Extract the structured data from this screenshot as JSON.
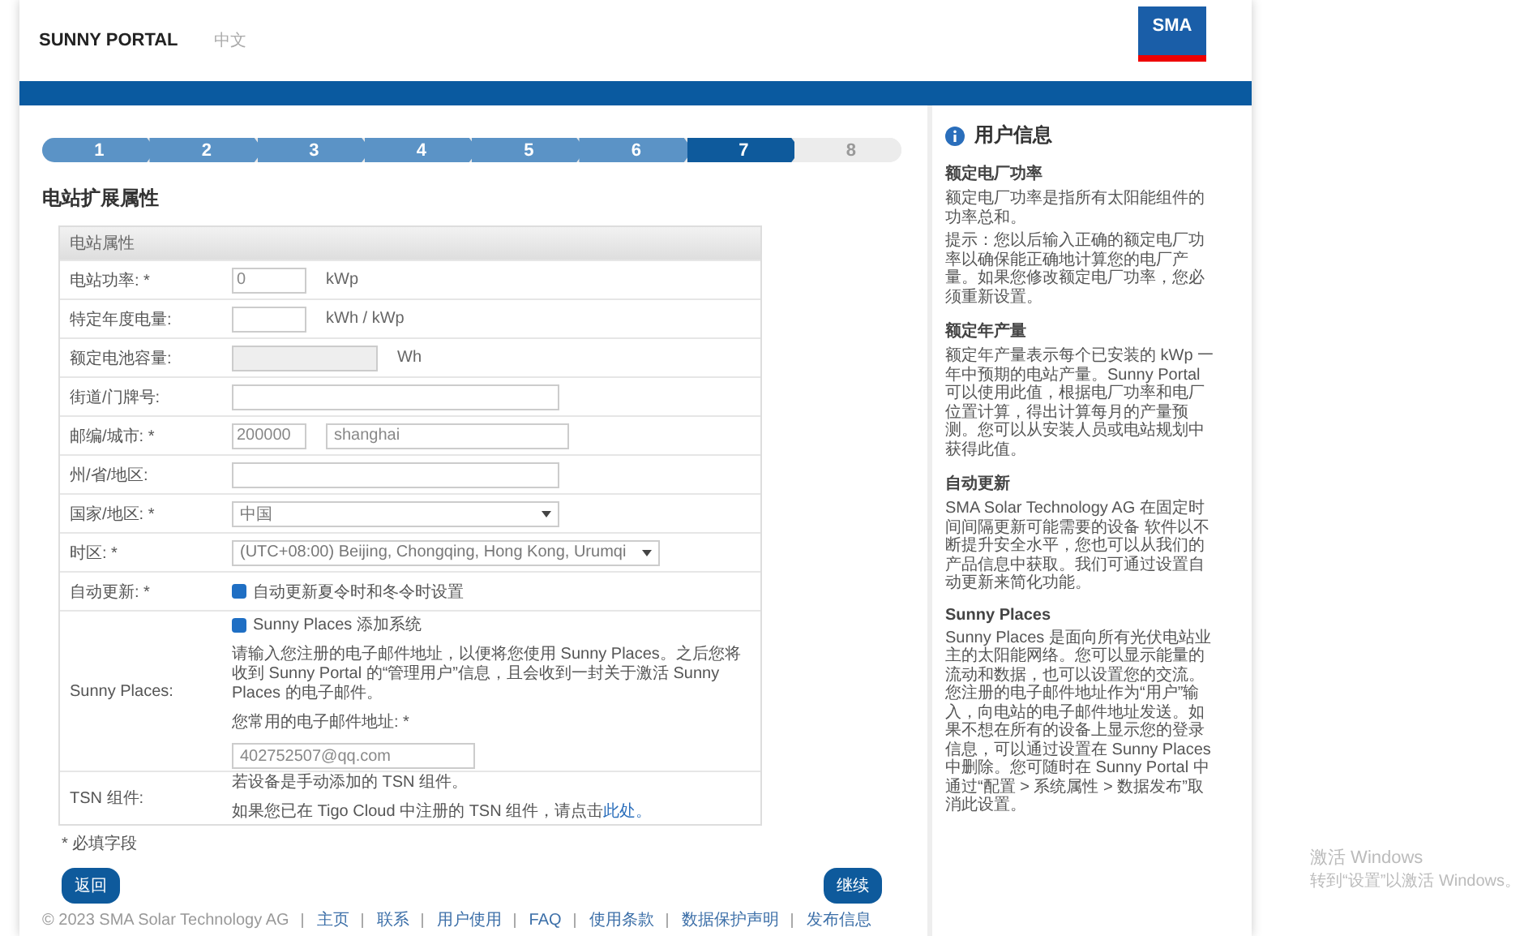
{
  "header": {
    "brand": "SUNNY PORTAL",
    "language": "中文",
    "logo": "SMA"
  },
  "steps": [
    {
      "label": "1",
      "selected": false,
      "completed": true
    },
    {
      "label": "2",
      "selected": false,
      "completed": true
    },
    {
      "label": "3",
      "selected": false,
      "completed": true
    },
    {
      "label": "4",
      "selected": false,
      "completed": true
    },
    {
      "label": "5",
      "selected": false,
      "completed": true
    },
    {
      "label": "6",
      "selected": false,
      "completed": true
    },
    {
      "label": "7",
      "selected": true,
      "completed": false
    },
    {
      "label": "8",
      "selected": false,
      "completed": false
    }
  ],
  "page_title": "电站扩展属性",
  "form": {
    "section_title": "电站属性",
    "rows": [
      {
        "label": "电站功率: *",
        "controls": [
          {
            "kind": "small-field",
            "value": "0",
            "disabled": false
          },
          {
            "kind": "unit",
            "text": "kWp"
          }
        ]
      },
      {
        "label": "特定年度电量:",
        "controls": [
          {
            "kind": "small-field",
            "disabled": false
          },
          {
            "kind": "unit",
            "text": "kWh / kWp"
          }
        ]
      },
      {
        "label": "额定电池容量:",
        "controls": [
          {
            "kind": "medium-field",
            "disabled": true
          },
          {
            "kind": "unit",
            "text": "Wh"
          }
        ]
      },
      {
        "label": "街道/门牌号:",
        "controls": [
          {
            "kind": "wide-field",
            "disabled": false
          }
        ]
      },
      {
        "label": "邮编/城市: *",
        "controls": [
          {
            "kind": "small-field",
            "value": "200000",
            "disabled": false
          },
          {
            "kind": "city-field",
            "value": "shanghai",
            "disabled": false
          }
        ]
      },
      {
        "label": "州/省/地区:",
        "controls": [
          {
            "kind": "wide-field",
            "disabled": false
          }
        ]
      },
      {
        "label": "国家/地区: *",
        "controls": [
          {
            "kind": "select",
            "value": "中国"
          }
        ]
      },
      {
        "label": "时区: *",
        "controls": [
          {
            "kind": "select",
            "value": "(UTC+08:00) Beijing, Chongqing, Hong Kong, Urumqi"
          }
        ]
      },
      {
        "label": "自动更新: *",
        "controls": [
          {
            "kind": "checkbox",
            "text": "自动更新夏令时和冬令时设置",
            "checked": true
          }
        ]
      },
      {
        "label": "Sunny Places:",
        "controls": [
          {
            "kind": "checkbox",
            "text": "Sunny Places 添加系统",
            "checked": true
          },
          {
            "kind": "note",
            "text": "请输入您注册的电子邮件地址，以便将您使用 Sunny Places。之后您将收到 Sunny Portal 的“管理用户”信息，且会收到一封关于激活 Sunny Places 的电子邮件。"
          },
          {
            "kind": "field-label",
            "text": "您常用的电子邮件地址: *"
          },
          {
            "kind": "email-field",
            "value": "402752507@qq.com",
            "disabled": false
          }
        ]
      },
      {
        "label": "TSN 组件:",
        "controls": [
          {
            "kind": "note",
            "text": "若设备是手动添加的 TSN 组件。"
          },
          {
            "kind": "note",
            "text": "如果您已在 Tigo Cloud 中注册的 TSN 组件，请点击",
            "link": "此处。"
          }
        ]
      }
    ]
  },
  "required_note": "* 必填字段",
  "buttons": {
    "back": "返回",
    "next": "继续"
  },
  "sidebar": {
    "title": "用户信息",
    "sections": [
      {
        "heading": "额定电厂功率",
        "paragraphs": [
          "额定电厂功率是指所有太阳能组件的功率总和。",
          "提示：您以后输入正确的额定电厂功率以确保能正确地计算您的电厂产量。如果您修改额定电厂功率，您必须重新设置。"
        ]
      },
      {
        "heading": "额定年产量",
        "paragraphs": [
          "额定年产量表示每个已安装的 kWp 一年中预期的电站产量。Sunny Portal 可以使用此值，根据电厂功率和电厂位置计算，得出计算每月的产量预测。您可以从安装人员或电站规划中获得此值。"
        ]
      },
      {
        "heading": "自动更新",
        "paragraphs": [
          "SMA Solar Technology AG 在固定时间间隔更新可能需要的设备 软件以不断提升安全水平，您也可以从我们的产品信息中获取。我们可通过设置自动更新来简化功能。"
        ]
      },
      {
        "heading": "Sunny Places",
        "paragraphs": [
          "Sunny Places 是面向所有光伏电站业主的太阳能网络。您可以显示能量的流动和数据，也可以设置您的交流。您注册的电子邮件地址作为“用户”输入，向电站的电子邮件地址发送。如果不想在所有的设备上显示您的登录信息，可以通过设置在 Sunny Places 中删除。您可随时在 Sunny Portal 中通过“配置 > 系统属性 > 数据发布”取消此设置。"
        ]
      }
    ]
  },
  "footer": {
    "copyright": "© 2023 SMA Solar Technology AG",
    "links": [
      "主页",
      "联系",
      "用户使用",
      "FAQ",
      "使用条款",
      "数据保护声明",
      "发布信息"
    ]
  },
  "os_notice": {
    "title": "激活 Windows",
    "text": "转到“设置”以激活 Windows。"
  }
}
